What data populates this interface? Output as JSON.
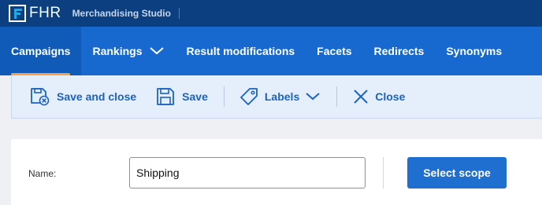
{
  "app": {
    "logo_text": "FHR",
    "studio_name": "Merchandising Studio"
  },
  "nav": {
    "items": [
      {
        "label": "Campaigns",
        "active": true
      },
      {
        "label": "Rankings",
        "has_dropdown": true
      },
      {
        "label": "Result modifications"
      },
      {
        "label": "Facets"
      },
      {
        "label": "Redirects"
      },
      {
        "label": "Synonyms"
      }
    ]
  },
  "toolbar": {
    "save_close_label": "Save and close",
    "save_label": "Save",
    "labels_label": "Labels",
    "close_label": "Close"
  },
  "form": {
    "name_label": "Name:",
    "name_value": "Shipping",
    "select_scope_label": "Select scope"
  },
  "colors": {
    "appbar": "#0b3f7f",
    "nav": "#1769d0",
    "nav_active": "#0f5bb7",
    "active_underline": "#f5a24a",
    "toolbar_text": "#1b63c2",
    "primary_button": "#1f6fd1"
  }
}
